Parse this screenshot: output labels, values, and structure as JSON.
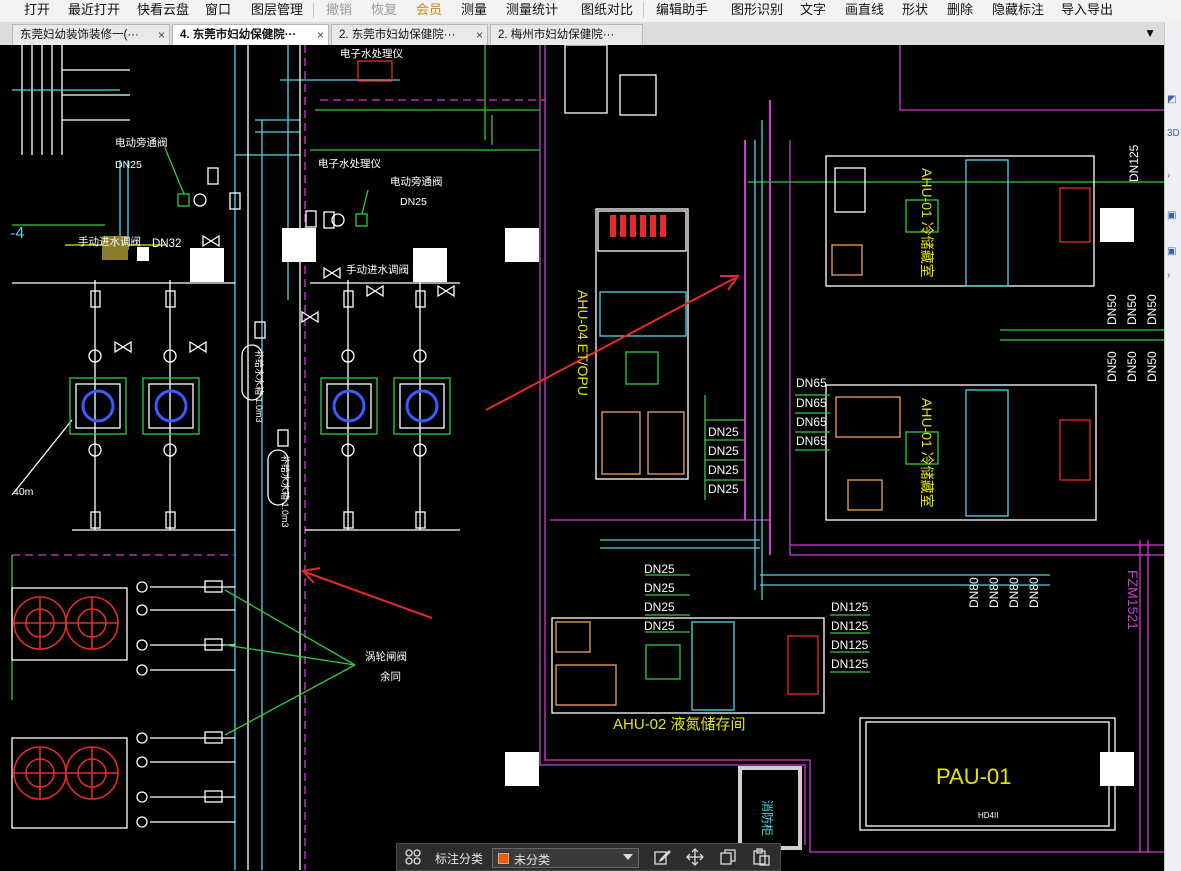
{
  "menu": {
    "items": [
      {
        "label": "打开",
        "state": "normal"
      },
      {
        "label": "最近打开",
        "state": "normal"
      },
      {
        "label": "快看云盘",
        "state": "normal"
      },
      {
        "label": "窗口",
        "state": "normal"
      },
      {
        "label": "图层管理",
        "state": "normal"
      },
      {
        "label": "撤销",
        "state": "disabled"
      },
      {
        "label": "恢复",
        "state": "disabled"
      },
      {
        "label": "会员",
        "state": "vip"
      },
      {
        "label": "测量",
        "state": "normal"
      },
      {
        "label": "测量统计",
        "state": "normal"
      },
      {
        "label": "图纸对比",
        "state": "normal"
      },
      {
        "label": "编辑助手",
        "state": "normal"
      },
      {
        "label": "图形识别",
        "state": "normal"
      },
      {
        "label": "文字",
        "state": "normal"
      },
      {
        "label": "画直线",
        "state": "normal"
      },
      {
        "label": "形状",
        "state": "normal"
      },
      {
        "label": "删除",
        "state": "normal"
      },
      {
        "label": "隐藏标注",
        "state": "normal"
      },
      {
        "label": "导入导出",
        "state": "normal"
      }
    ]
  },
  "tabs": [
    {
      "label": "东莞妇幼装饰装修一(···",
      "close": "×",
      "active": false
    },
    {
      "label": "4. 东莞市妇幼保健院···",
      "close": "×",
      "active": true
    },
    {
      "label": "2. 东莞市妇幼保健院···",
      "close": "×",
      "active": false
    },
    {
      "label": "2. 梅州市妇幼保健院···",
      "close": "",
      "active": false
    }
  ],
  "tab_overflow": "▼",
  "drawing": {
    "labels": {
      "e_water_1": "电子水处理仪",
      "e_water_2": "电子水处理仪",
      "bypass_valve_1": "电动旁通阀",
      "bypass_valve_2": "电动旁通阀",
      "dn25_a": "DN25",
      "dn25_b": "DN25",
      "dn32": "DN32",
      "manual_valve_1": "手动进水调阀",
      "manual_valve_2": "手动进水调阀",
      "tank_1": "补给水水箱 1.0m3",
      "tank_2": "补给水水箱 1.0m3",
      "butterfly": "涡轮闸阀",
      "remaining": "余同",
      "len": "40m",
      "left_edge": "-4",
      "ahu04": "AHU-04 ET/OPU",
      "ahu01_top": "AHU-01 冷储藏室",
      "ahu01_mid": "AHU-01 冷储藏室",
      "ahu02": "AHU-02 液氮储存间",
      "pau01": "PAU-01",
      "pau_small": "HD4II",
      "fzm": "FZM1521",
      "fire": "消防柜",
      "dn125": "DN125",
      "dn50": "DN50",
      "dn65": "DN65",
      "dn80": "DN80"
    }
  },
  "bottom_toolbar": {
    "label": "标注分类",
    "select_value": "未分类",
    "swatch_color": "#e85d0c",
    "icons": [
      "grid-icon",
      "edit-icon",
      "move-icon",
      "copy-icon",
      "paste-icon"
    ]
  },
  "colors": {
    "cad_background": "#000000",
    "cyan": "#4dd6e6",
    "magenta": "#d23ad2",
    "green": "#2ecc40",
    "red_arrow": "#e32b2b",
    "yellow": "#e6e600"
  }
}
